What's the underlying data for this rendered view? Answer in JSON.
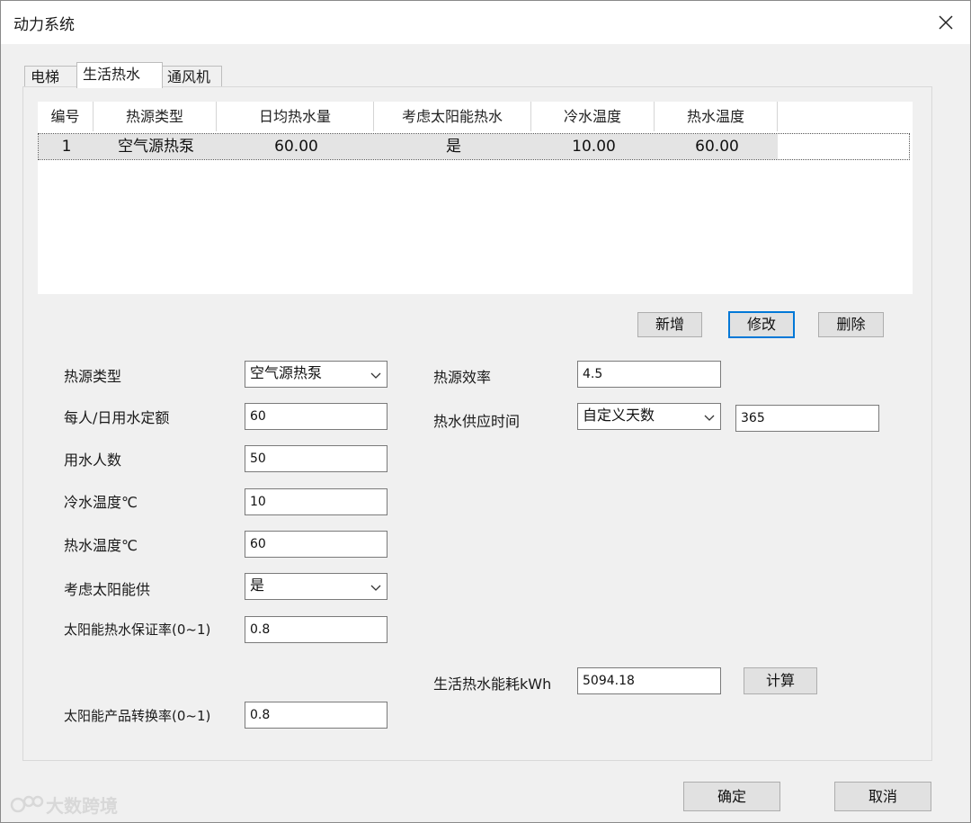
{
  "window": {
    "title": "动力系统"
  },
  "tabs": [
    {
      "label": "电梯"
    },
    {
      "label": "生活热水",
      "active": true
    },
    {
      "label": "通风机"
    }
  ],
  "grid": {
    "columns": [
      "编号",
      "热源类型",
      "日均热水量",
      "考虑太阳能热水",
      "冷水温度",
      "热水温度"
    ],
    "rows": [
      [
        "1",
        "空气源热泵",
        "60.00",
        "是",
        "10.00",
        "60.00"
      ]
    ]
  },
  "grid_buttons": {
    "add": "新增",
    "edit": "修改",
    "delete": "删除"
  },
  "form": {
    "heat_source_type": {
      "label": "热源类型",
      "value": "空气源热泵"
    },
    "per_person_quota": {
      "label": "每人/日用水定额",
      "value": "60"
    },
    "people_count": {
      "label": "用水人数",
      "value": "50"
    },
    "cold_water_temp": {
      "label": "冷水温度℃",
      "value": "10"
    },
    "hot_water_temp": {
      "label": "热水温度℃",
      "value": "60"
    },
    "consider_solar": {
      "label": "考虑太阳能供",
      "value": "是"
    },
    "solar_guarantee_rate": {
      "label": "太阳能热水保证率(0~1)",
      "value": "0.8"
    },
    "solar_conversion_rate": {
      "label": "太阳能产品转换率(0~1)",
      "value": "0.8"
    },
    "heat_source_efficiency": {
      "label": "热源效率",
      "value": "4.5"
    },
    "supply_time": {
      "label": "热水供应时间",
      "mode": "自定义天数",
      "days": "365"
    },
    "energy": {
      "label": "生活热水能耗kWh",
      "value": "5094.18",
      "calc_button": "计算"
    }
  },
  "footer": {
    "ok": "确定",
    "cancel": "取消"
  },
  "watermark": {
    "text": "大数跨境"
  },
  "colors": {
    "focus": "#0078d7",
    "row_selected": "#e4e4e4"
  }
}
